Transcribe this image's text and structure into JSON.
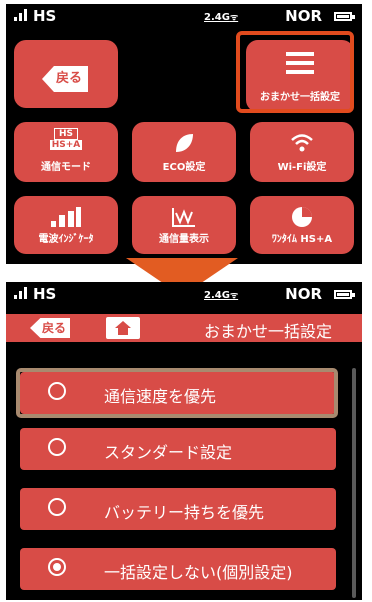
{
  "status": {
    "carrier": "HS",
    "band": "2.4G",
    "mode": "NOR"
  },
  "screen1": {
    "back_label": "戻る",
    "tiles": [
      {
        "label": "おまかせ一括設定",
        "icon": "menu-icon"
      },
      {
        "label": "通信モード",
        "icon_text_top": "HS",
        "icon_text_bottom": "HS+A",
        "icon": "hs-mode-icon"
      },
      {
        "label": "ECO設定",
        "icon": "leaf-icon"
      },
      {
        "label": "Wi-Fi設定",
        "icon": "wifi-icon"
      },
      {
        "label": "電波ｲﾝｼﾞｹｰﾀ",
        "icon": "signal-bars-icon"
      },
      {
        "label": "通信量表示",
        "icon": "traffic-graph-icon"
      },
      {
        "label": "ﾜﾝﾀｲﾑ HS+A",
        "icon": "clock-pie-icon"
      }
    ]
  },
  "screen2": {
    "back_label": "戻る",
    "title": "おまかせ一括設定",
    "options": [
      {
        "label": "通信速度を優先",
        "selected": false
      },
      {
        "label": "スタンダード設定",
        "selected": false
      },
      {
        "label": "バッテリー持ちを優先",
        "selected": false
      },
      {
        "label": "一括設定しない(個別設定)",
        "selected": true
      }
    ]
  },
  "colors": {
    "tile": "#d84c47",
    "highlight": "#e24b1e",
    "arrow": "#e25c22"
  }
}
